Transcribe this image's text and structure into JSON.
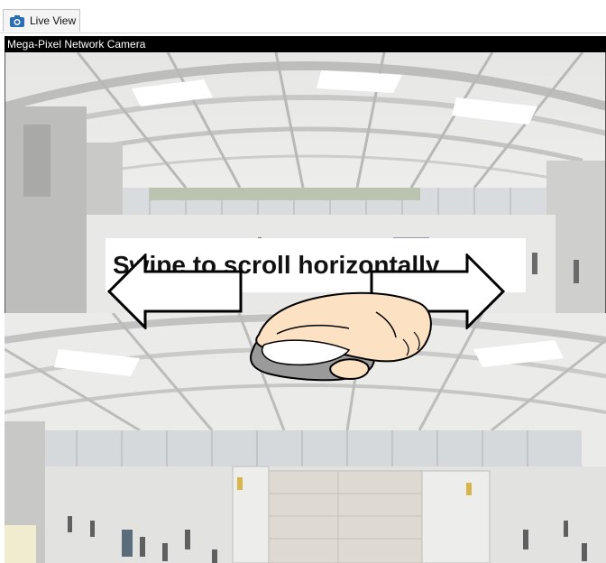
{
  "tab": {
    "label": "Live View",
    "icon": "camera-icon"
  },
  "window": {
    "title": "Mega-Pixel Network Camera"
  },
  "overlay": {
    "instruction": "Swipe to scroll horizontally",
    "left_arrow": "left-arrow-icon",
    "right_arrow": "right-arrow-icon",
    "hand": "hand-on-mouse-icon"
  },
  "colors": {
    "title_bar": "#000000",
    "tab_bg": "#f4f4f4",
    "camera_icon": "#2a6fb6"
  }
}
